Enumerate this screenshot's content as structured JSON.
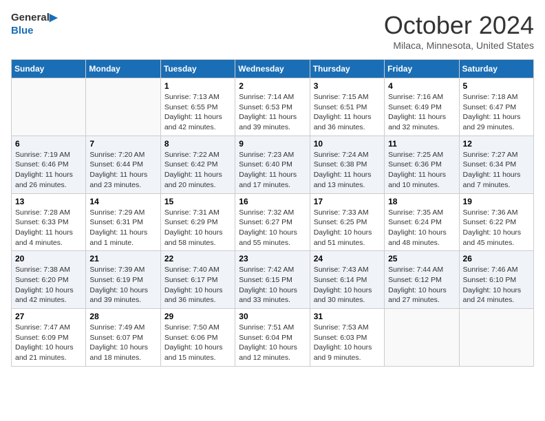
{
  "logo": {
    "text_general": "General",
    "text_blue": "Blue"
  },
  "header": {
    "month": "October 2024",
    "location": "Milaca, Minnesota, United States"
  },
  "weekdays": [
    "Sunday",
    "Monday",
    "Tuesday",
    "Wednesday",
    "Thursday",
    "Friday",
    "Saturday"
  ],
  "weeks": [
    [
      {
        "day": "",
        "sunrise": "",
        "sunset": "",
        "daylight": ""
      },
      {
        "day": "",
        "sunrise": "",
        "sunset": "",
        "daylight": ""
      },
      {
        "day": "1",
        "sunrise": "Sunrise: 7:13 AM",
        "sunset": "Sunset: 6:55 PM",
        "daylight": "Daylight: 11 hours and 42 minutes."
      },
      {
        "day": "2",
        "sunrise": "Sunrise: 7:14 AM",
        "sunset": "Sunset: 6:53 PM",
        "daylight": "Daylight: 11 hours and 39 minutes."
      },
      {
        "day": "3",
        "sunrise": "Sunrise: 7:15 AM",
        "sunset": "Sunset: 6:51 PM",
        "daylight": "Daylight: 11 hours and 36 minutes."
      },
      {
        "day": "4",
        "sunrise": "Sunrise: 7:16 AM",
        "sunset": "Sunset: 6:49 PM",
        "daylight": "Daylight: 11 hours and 32 minutes."
      },
      {
        "day": "5",
        "sunrise": "Sunrise: 7:18 AM",
        "sunset": "Sunset: 6:47 PM",
        "daylight": "Daylight: 11 hours and 29 minutes."
      }
    ],
    [
      {
        "day": "6",
        "sunrise": "Sunrise: 7:19 AM",
        "sunset": "Sunset: 6:46 PM",
        "daylight": "Daylight: 11 hours and 26 minutes."
      },
      {
        "day": "7",
        "sunrise": "Sunrise: 7:20 AM",
        "sunset": "Sunset: 6:44 PM",
        "daylight": "Daylight: 11 hours and 23 minutes."
      },
      {
        "day": "8",
        "sunrise": "Sunrise: 7:22 AM",
        "sunset": "Sunset: 6:42 PM",
        "daylight": "Daylight: 11 hours and 20 minutes."
      },
      {
        "day": "9",
        "sunrise": "Sunrise: 7:23 AM",
        "sunset": "Sunset: 6:40 PM",
        "daylight": "Daylight: 11 hours and 17 minutes."
      },
      {
        "day": "10",
        "sunrise": "Sunrise: 7:24 AM",
        "sunset": "Sunset: 6:38 PM",
        "daylight": "Daylight: 11 hours and 13 minutes."
      },
      {
        "day": "11",
        "sunrise": "Sunrise: 7:25 AM",
        "sunset": "Sunset: 6:36 PM",
        "daylight": "Daylight: 11 hours and 10 minutes."
      },
      {
        "day": "12",
        "sunrise": "Sunrise: 7:27 AM",
        "sunset": "Sunset: 6:34 PM",
        "daylight": "Daylight: 11 hours and 7 minutes."
      }
    ],
    [
      {
        "day": "13",
        "sunrise": "Sunrise: 7:28 AM",
        "sunset": "Sunset: 6:33 PM",
        "daylight": "Daylight: 11 hours and 4 minutes."
      },
      {
        "day": "14",
        "sunrise": "Sunrise: 7:29 AM",
        "sunset": "Sunset: 6:31 PM",
        "daylight": "Daylight: 11 hours and 1 minute."
      },
      {
        "day": "15",
        "sunrise": "Sunrise: 7:31 AM",
        "sunset": "Sunset: 6:29 PM",
        "daylight": "Daylight: 10 hours and 58 minutes."
      },
      {
        "day": "16",
        "sunrise": "Sunrise: 7:32 AM",
        "sunset": "Sunset: 6:27 PM",
        "daylight": "Daylight: 10 hours and 55 minutes."
      },
      {
        "day": "17",
        "sunrise": "Sunrise: 7:33 AM",
        "sunset": "Sunset: 6:25 PM",
        "daylight": "Daylight: 10 hours and 51 minutes."
      },
      {
        "day": "18",
        "sunrise": "Sunrise: 7:35 AM",
        "sunset": "Sunset: 6:24 PM",
        "daylight": "Daylight: 10 hours and 48 minutes."
      },
      {
        "day": "19",
        "sunrise": "Sunrise: 7:36 AM",
        "sunset": "Sunset: 6:22 PM",
        "daylight": "Daylight: 10 hours and 45 minutes."
      }
    ],
    [
      {
        "day": "20",
        "sunrise": "Sunrise: 7:38 AM",
        "sunset": "Sunset: 6:20 PM",
        "daylight": "Daylight: 10 hours and 42 minutes."
      },
      {
        "day": "21",
        "sunrise": "Sunrise: 7:39 AM",
        "sunset": "Sunset: 6:19 PM",
        "daylight": "Daylight: 10 hours and 39 minutes."
      },
      {
        "day": "22",
        "sunrise": "Sunrise: 7:40 AM",
        "sunset": "Sunset: 6:17 PM",
        "daylight": "Daylight: 10 hours and 36 minutes."
      },
      {
        "day": "23",
        "sunrise": "Sunrise: 7:42 AM",
        "sunset": "Sunset: 6:15 PM",
        "daylight": "Daylight: 10 hours and 33 minutes."
      },
      {
        "day": "24",
        "sunrise": "Sunrise: 7:43 AM",
        "sunset": "Sunset: 6:14 PM",
        "daylight": "Daylight: 10 hours and 30 minutes."
      },
      {
        "day": "25",
        "sunrise": "Sunrise: 7:44 AM",
        "sunset": "Sunset: 6:12 PM",
        "daylight": "Daylight: 10 hours and 27 minutes."
      },
      {
        "day": "26",
        "sunrise": "Sunrise: 7:46 AM",
        "sunset": "Sunset: 6:10 PM",
        "daylight": "Daylight: 10 hours and 24 minutes."
      }
    ],
    [
      {
        "day": "27",
        "sunrise": "Sunrise: 7:47 AM",
        "sunset": "Sunset: 6:09 PM",
        "daylight": "Daylight: 10 hours and 21 minutes."
      },
      {
        "day": "28",
        "sunrise": "Sunrise: 7:49 AM",
        "sunset": "Sunset: 6:07 PM",
        "daylight": "Daylight: 10 hours and 18 minutes."
      },
      {
        "day": "29",
        "sunrise": "Sunrise: 7:50 AM",
        "sunset": "Sunset: 6:06 PM",
        "daylight": "Daylight: 10 hours and 15 minutes."
      },
      {
        "day": "30",
        "sunrise": "Sunrise: 7:51 AM",
        "sunset": "Sunset: 6:04 PM",
        "daylight": "Daylight: 10 hours and 12 minutes."
      },
      {
        "day": "31",
        "sunrise": "Sunrise: 7:53 AM",
        "sunset": "Sunset: 6:03 PM",
        "daylight": "Daylight: 10 hours and 9 minutes."
      },
      {
        "day": "",
        "sunrise": "",
        "sunset": "",
        "daylight": ""
      },
      {
        "day": "",
        "sunrise": "",
        "sunset": "",
        "daylight": ""
      }
    ]
  ]
}
